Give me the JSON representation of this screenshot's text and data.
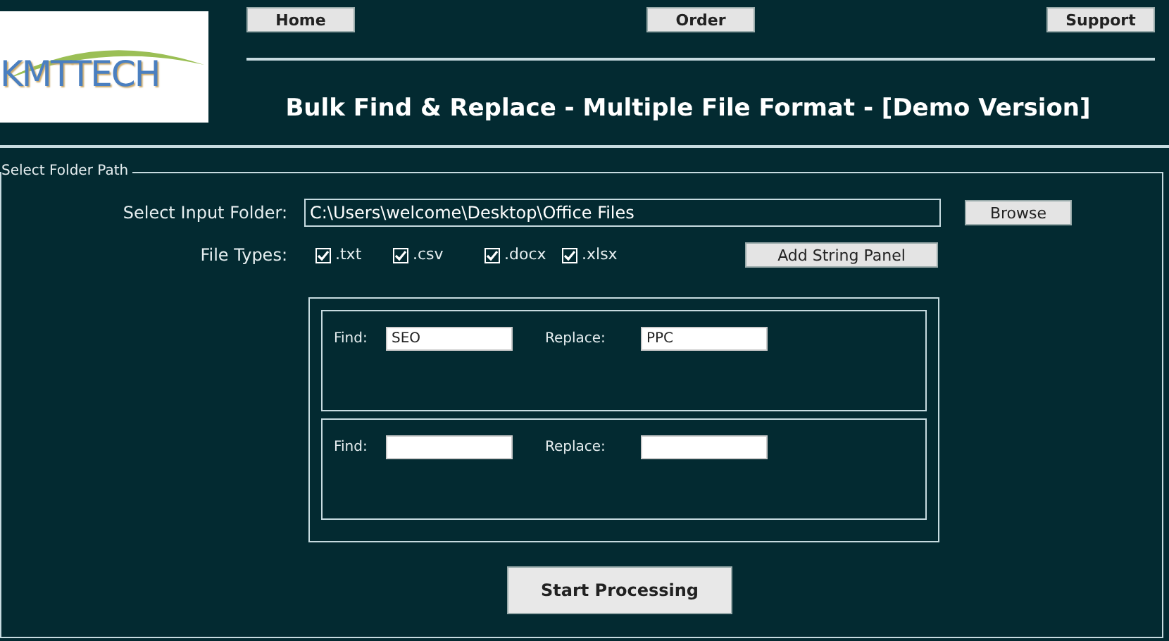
{
  "logo": {
    "text": "KMTTECH"
  },
  "nav": [
    "Home",
    "Order",
    "Support"
  ],
  "title": "Bulk Find & Replace - Multiple File Format - [Demo Version]",
  "folder_group": {
    "legend": "Select Folder Path",
    "input_label": "Select Input Folder:",
    "input_value": "C:\\Users\\welcome\\Desktop\\Office Files",
    "browse_button": "Browse",
    "file_types_label": "File Types:",
    "file_types": [
      {
        "label": ".txt",
        "checked": true
      },
      {
        "label": ".csv",
        "checked": true
      },
      {
        "label": ".docx",
        "checked": true
      },
      {
        "label": ".xlsx",
        "checked": true
      }
    ],
    "add_button": "Add String Panel"
  },
  "string_panels": [
    {
      "find_label": "Find:",
      "find_value": "SEO",
      "replace_label": "Replace:",
      "replace_value": "PPC"
    },
    {
      "find_label": "Find:",
      "replace_label": "Replace:"
    }
  ],
  "start_button": "Start Processing"
}
